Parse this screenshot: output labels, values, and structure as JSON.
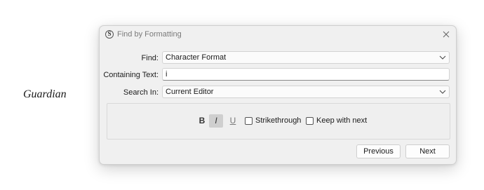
{
  "background": {
    "text": "Guardian"
  },
  "dialog": {
    "title": "Find by Formatting",
    "app_icon_letter": "S",
    "find_label": "Find:",
    "find_value": "Character Format",
    "containing_label": "Containing Text:",
    "containing_value": "i",
    "search_in_label": "Search In:",
    "search_in_value": "Current Editor",
    "format": {
      "bold": "B",
      "italic": "I",
      "underline": "U",
      "italic_active": true
    },
    "strikethrough_label": "Strikethrough",
    "strikethrough_checked": false,
    "keep_with_next_label": "Keep with next",
    "keep_with_next_checked": false,
    "previous_label": "Previous",
    "next_label": "Next"
  },
  "colors": {
    "dialog_bg": "#f0f0f0",
    "active_toggle": "#cfcfcf"
  }
}
